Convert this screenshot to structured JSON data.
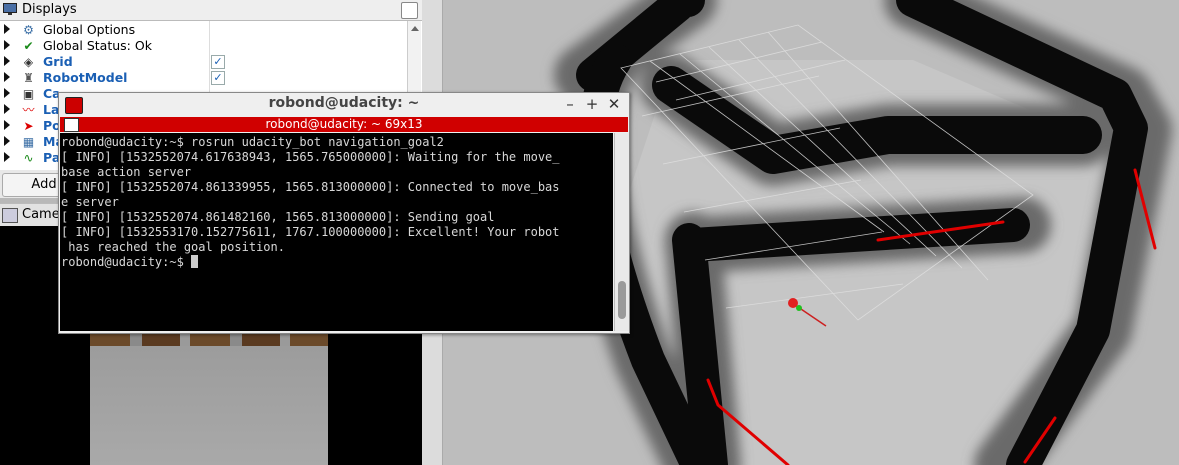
{
  "displays": {
    "title": "Displays",
    "items": [
      {
        "label": "Global Options",
        "icon": "gear-icon",
        "style": "normal",
        "checked": null
      },
      {
        "label": "Global Status: Ok",
        "icon": "checkmark-icon",
        "style": "normal",
        "checked": null
      },
      {
        "label": "Grid",
        "icon": "grid-icon",
        "style": "blue",
        "checked": true
      },
      {
        "label": "RobotModel",
        "icon": "robot-model-icon",
        "style": "blue",
        "checked": true
      },
      {
        "label": "Ca",
        "icon": "camera-icon",
        "style": "blue",
        "checked": null
      },
      {
        "label": "La",
        "icon": "laser-scan-icon",
        "style": "blue",
        "checked": null
      },
      {
        "label": "Po",
        "icon": "pose-icon",
        "style": "blue",
        "checked": null
      },
      {
        "label": "Ma",
        "icon": "map-icon",
        "style": "blue",
        "checked": null
      },
      {
        "label": "Pa",
        "icon": "path-icon",
        "style": "blue",
        "checked": null
      }
    ],
    "add_button": "Add",
    "check_glyph": "✓"
  },
  "camera_panel": {
    "title": "Came"
  },
  "terminal": {
    "title": "robond@udacity: ~",
    "tab_label": "robond@udacity: ~ 69x13",
    "buttons": {
      "minimize": "–",
      "maximize": "+",
      "close": "✕"
    },
    "lines": [
      "robond@udacity:~$ rosrun udacity_bot navigation_goal2",
      "[ INFO] [1532552074.617638943, 1565.765000000]: Waiting for the move_",
      "base action server",
      "[ INFO] [1532552074.861339955, 1565.813000000]: Connected to move_bas",
      "e server",
      "[ INFO] [1532552074.861482160, 1565.813000000]: Sending goal",
      "[ INFO] [1532553170.152775611, 1767.100000000]: Excellent! Your robot",
      " has reached the goal position."
    ],
    "prompt": "robond@udacity:~$ "
  },
  "colors": {
    "terminal_tab": "#d00000",
    "laser": "#e00000",
    "link_blue": "#1a5fb4"
  }
}
